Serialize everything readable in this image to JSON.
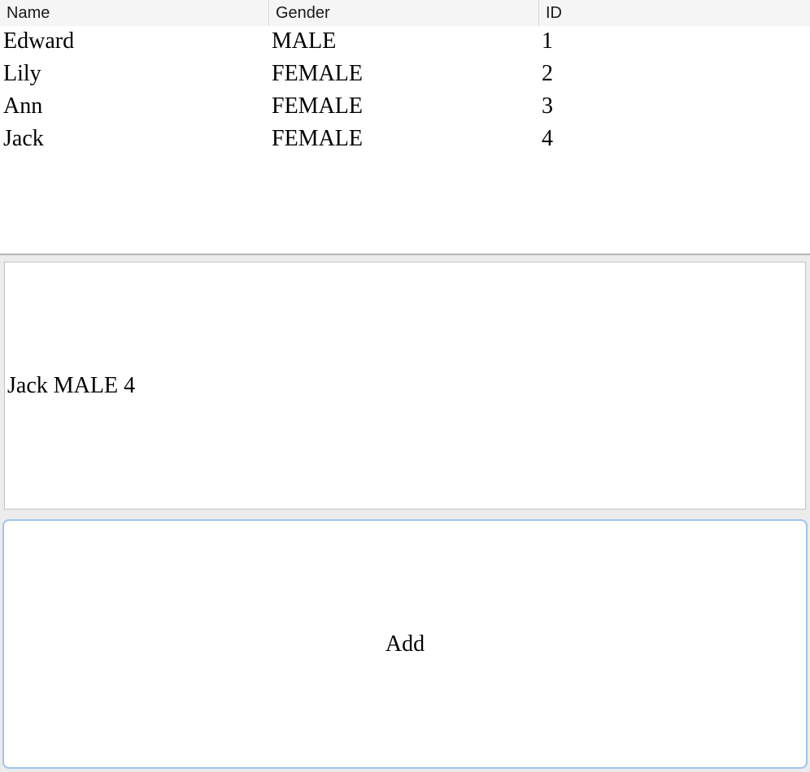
{
  "table": {
    "columns": [
      "Name",
      "Gender",
      "ID"
    ],
    "rows": [
      {
        "name": "Edward",
        "gender": "MALE",
        "id": "1"
      },
      {
        "name": "Lily",
        "gender": "FEMALE",
        "id": "2"
      },
      {
        "name": "Ann",
        "gender": "FEMALE",
        "id": "3"
      },
      {
        "name": "Jack",
        "gender": "FEMALE",
        "id": "4"
      }
    ]
  },
  "display": {
    "text": "Jack MALE 4"
  },
  "add_button": {
    "label": "Add"
  },
  "colors": {
    "button_border": "#9fc4ef",
    "window_background": "#ececec",
    "header_background": "#f5f5f5"
  }
}
